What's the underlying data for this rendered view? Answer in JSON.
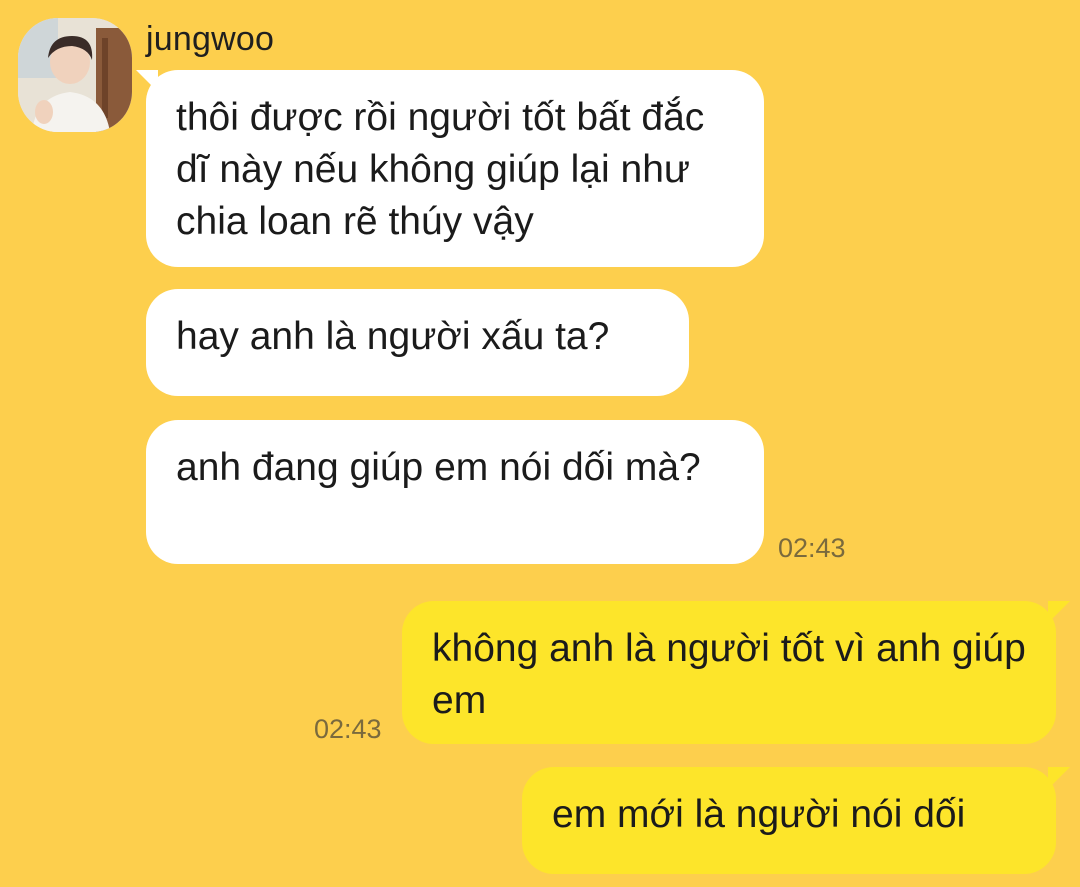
{
  "contact": {
    "name": "jungwoo"
  },
  "messages": [
    {
      "side": "incoming",
      "text": "thôi được rồi người tốt bất đắc dĩ này nếu không giúp lại như chia loan rẽ thúy vậy"
    },
    {
      "side": "incoming",
      "text": "hay anh là người xấu ta?"
    },
    {
      "side": "incoming",
      "text": "anh đang giúp em nói dối mà?",
      "time": "02:43"
    },
    {
      "side": "outgoing",
      "text": "không anh là người tốt vì anh giúp em",
      "time": "02:43"
    },
    {
      "side": "outgoing",
      "text": "em mới là người nói dối"
    }
  ],
  "colors": {
    "background": "#fdcf4d",
    "incoming_bubble": "#ffffff",
    "outgoing_bubble": "#fde52a",
    "timestamp": "#7a6a3d"
  }
}
